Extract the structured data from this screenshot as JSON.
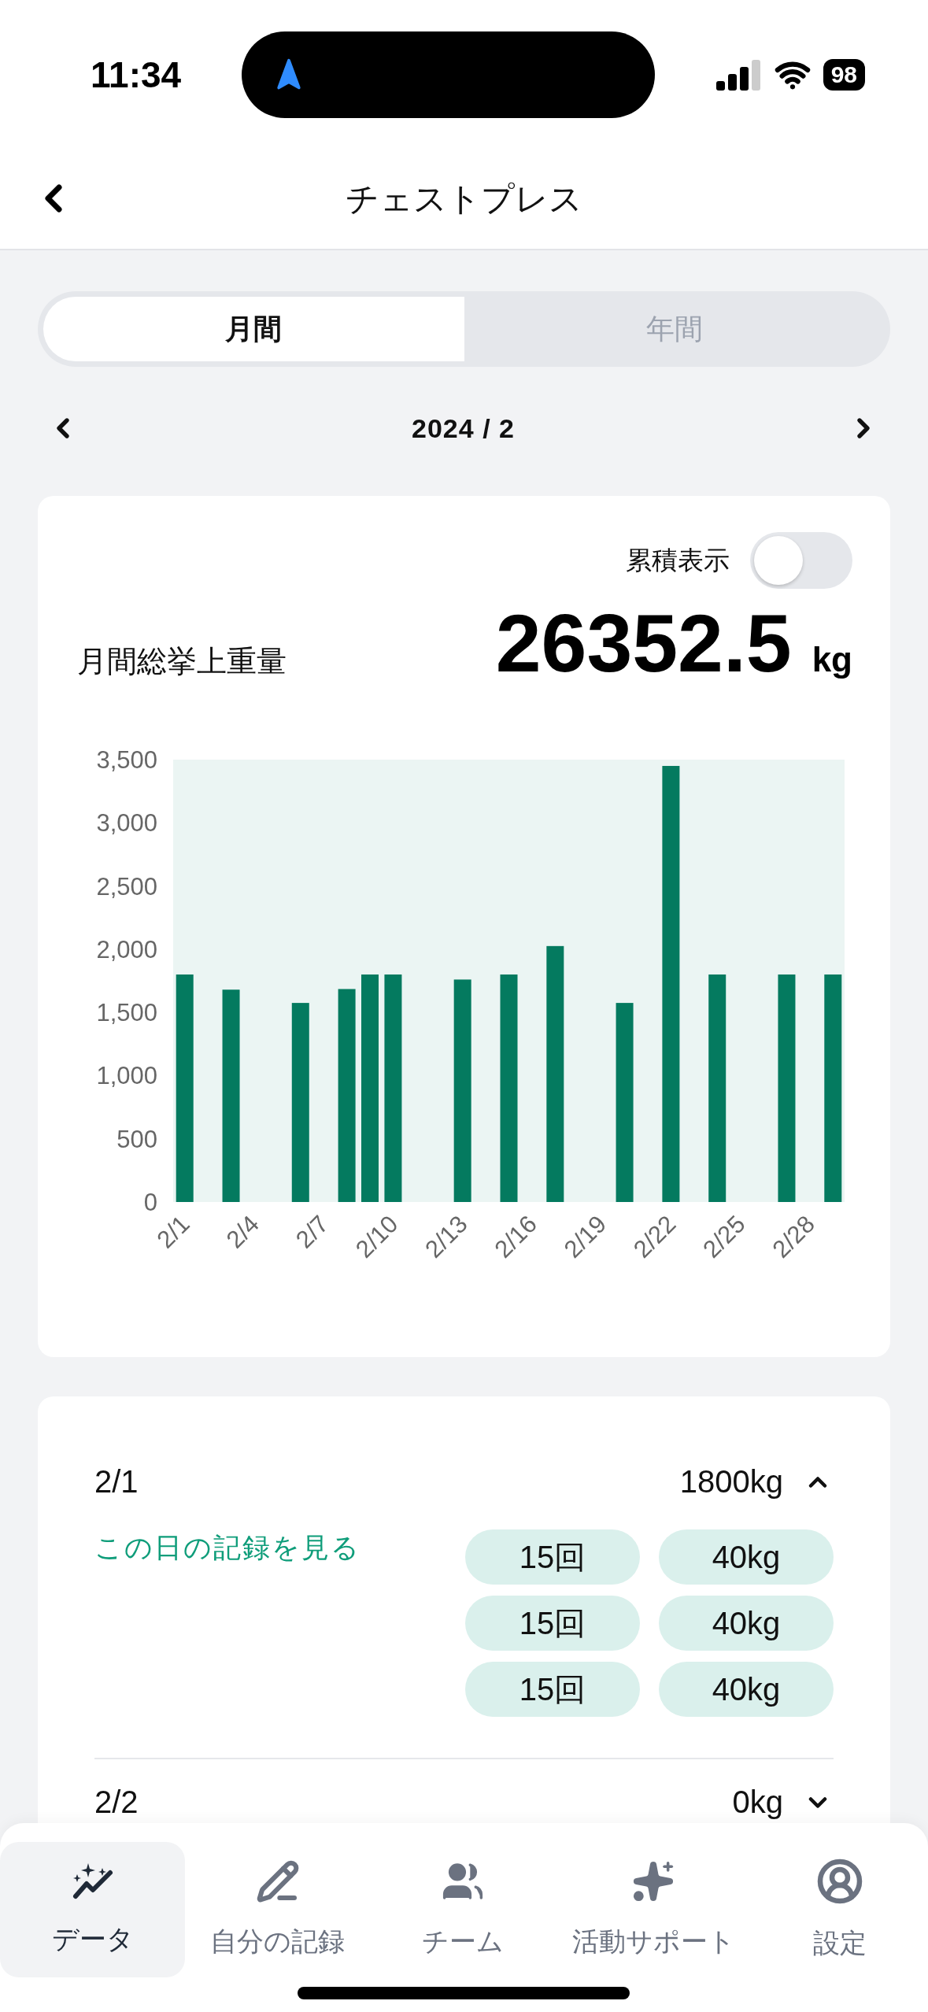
{
  "status_bar": {
    "time": "11:34",
    "battery": "98"
  },
  "header": {
    "title": "チェストプレス"
  },
  "period_tabs": [
    {
      "label": "月間",
      "selected": true
    },
    {
      "label": "年間",
      "selected": false
    }
  ],
  "month_nav": {
    "label": "2024 / 2"
  },
  "summary": {
    "cumulative_toggle": {
      "label": "累積表示",
      "on": false
    },
    "total_label": "月間総挙上重量",
    "total_value": "26352.5",
    "total_unit": "kg",
    "chart_data": {
      "type": "bar",
      "categories": [
        "2/1",
        null,
        null,
        "2/4",
        null,
        null,
        "2/7",
        null,
        null,
        "2/10",
        null,
        null,
        "2/13",
        null,
        null,
        "2/16",
        null,
        null,
        "2/19",
        null,
        null,
        "2/22",
        null,
        null,
        "2/25",
        null,
        null,
        "2/28",
        null
      ],
      "series": [
        {
          "color": "#047a5f",
          "values": [
            1800,
            null,
            1680,
            null,
            null,
            1575,
            null,
            1685,
            1800,
            1800,
            null,
            null,
            1760,
            null,
            1800,
            null,
            2025,
            null,
            null,
            1575,
            null,
            3450,
            null,
            1800,
            null,
            null,
            1800,
            null,
            1800
          ]
        }
      ],
      "ylim": [
        0,
        3500
      ],
      "yticks": [
        {
          "value": 0,
          "label": "0"
        },
        {
          "value": 500,
          "label": "500"
        },
        {
          "value": 1000,
          "label": "1,000"
        },
        {
          "value": 1500,
          "label": "1,500"
        },
        {
          "value": 2000,
          "label": "2,000"
        },
        {
          "value": 2500,
          "label": "2,500"
        },
        {
          "value": 3000,
          "label": "3,000"
        },
        {
          "value": 3500,
          "label": "3,500"
        }
      ]
    }
  },
  "records": [
    {
      "date": "2/1",
      "total": "1800kg",
      "expanded": true,
      "link": "この日の記録を見る",
      "sets": [
        {
          "reps": "15回",
          "weight": "40kg"
        },
        {
          "reps": "15回",
          "weight": "40kg"
        },
        {
          "reps": "15回",
          "weight": "40kg"
        }
      ]
    },
    {
      "date": "2/2",
      "total": "0kg",
      "expanded": false
    }
  ],
  "tab_bar": [
    {
      "label": "データ",
      "selected": true
    },
    {
      "label": "自分の記録",
      "selected": false
    },
    {
      "label": "チーム",
      "selected": false
    },
    {
      "label": "活動サポート",
      "selected": false
    },
    {
      "label": "設定",
      "selected": false
    }
  ]
}
